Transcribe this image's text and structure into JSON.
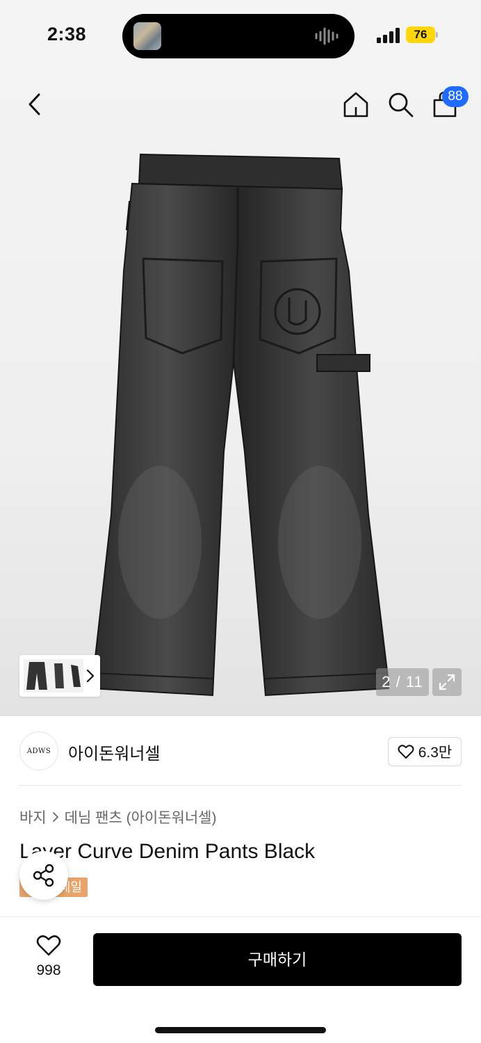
{
  "status": {
    "time": "2:38",
    "battery": "76"
  },
  "header": {
    "cart_count": "88"
  },
  "gallery": {
    "counter": "2 / 11"
  },
  "brand": {
    "logo_text": "ADWS",
    "name": "아이돈워너셀",
    "likes": "6.3만"
  },
  "breadcrumb": {
    "category": "바지",
    "subcategory": "데님 팬츠 (아이돈워너셀)"
  },
  "product": {
    "title": "Layer Curve Denim Pants Black",
    "tag": "세일"
  },
  "bottom": {
    "wish_count": "998",
    "buy_label": "구매하기"
  },
  "colors": {
    "accent_blue": "#1f6bff",
    "sale_tag": "#e8a46a",
    "buy_button": "#000000",
    "battery": "#ffd60a"
  },
  "icons": [
    "back-icon",
    "home-icon",
    "search-icon",
    "bag-icon",
    "chevron-right-icon",
    "expand-icon",
    "heart-icon",
    "share-icon",
    "signal-icon",
    "battery-icon",
    "sound-wave-icon"
  ]
}
